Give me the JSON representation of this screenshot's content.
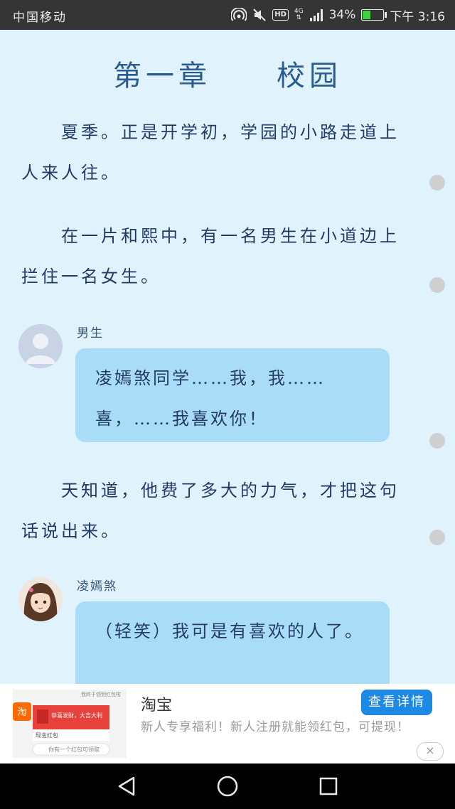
{
  "status_bar": {
    "carrier": "中国移动",
    "network": "4G",
    "hd": "HD",
    "battery_text": "34%",
    "battery_level": 0.34,
    "time": "下午 3:16",
    "icons": [
      "hotspot-icon",
      "mute-icon",
      "hd-icon",
      "signal-icon",
      "battery-icon"
    ]
  },
  "chapter": {
    "title": "第一章　　校园"
  },
  "story": {
    "para1": "夏季。正是开学初，学园的小路走道上人来人往。",
    "para2": "在一片和熙中，有一名男生在小道边上拦住一名女生。",
    "dialog1": {
      "speaker": "男生",
      "text": "凌嫣煞同学……我，我……喜，……我喜欢你！"
    },
    "para3": "天知道，他费了多大的力气，才把这句话说出来。",
    "dialog2": {
      "speaker": "凌嫣煞",
      "text": "（轻笑）我可是有喜欢的人了。"
    }
  },
  "ad": {
    "title": "淘宝",
    "description": "新人专享福利！新人注册就能领红包，可提现！",
    "button": "查看详情",
    "close": "×",
    "image": {
      "header": "我终于领到红包啦",
      "banner": "恭喜发财，大吉大利",
      "label": "现金红包",
      "footer": "你有一个红包可领取"
    }
  },
  "colors": {
    "background": "#e0f3fd",
    "bubble": "#a9ddf7",
    "text": "#233a66",
    "title": "#2b5c8f",
    "ad_button": "#1e88e5"
  },
  "nav": {
    "icons": [
      "back-icon",
      "home-icon",
      "recents-icon"
    ]
  }
}
